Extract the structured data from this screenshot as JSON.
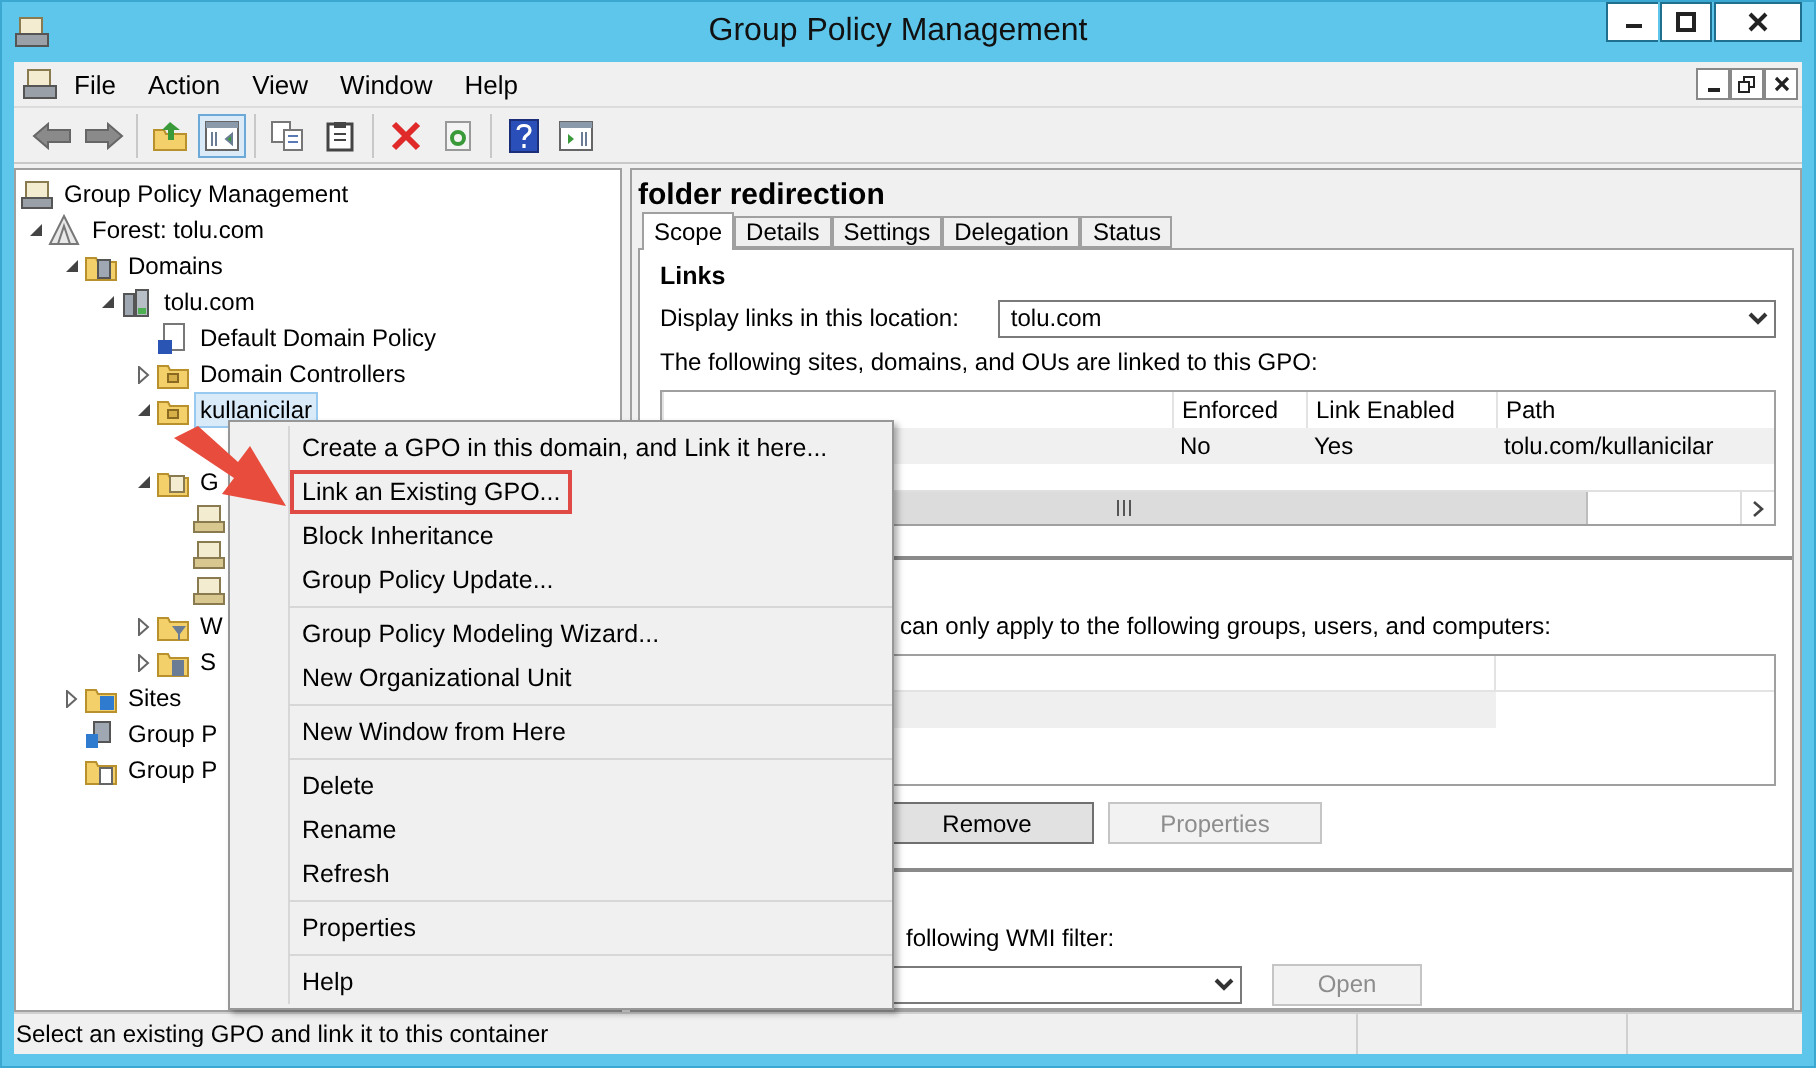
{
  "window": {
    "title": "Group Policy Management"
  },
  "menubar": [
    "File",
    "Action",
    "View",
    "Window",
    "Help"
  ],
  "toolbar": [
    [
      {
        "kind": "back",
        "pressed": false
      },
      {
        "kind": "forward",
        "pressed": false
      }
    ],
    [
      {
        "kind": "up",
        "pressed": false
      },
      {
        "kind": "tree",
        "pressed": true
      }
    ],
    [
      {
        "kind": "copy",
        "pressed": false
      },
      {
        "kind": "paste",
        "pressed": false
      }
    ],
    [
      {
        "kind": "delete",
        "pressed": false
      },
      {
        "kind": "refresh",
        "pressed": false
      }
    ],
    [
      {
        "kind": "help",
        "pressed": false
      },
      {
        "kind": "pane",
        "pressed": false
      }
    ]
  ],
  "tree": [
    {
      "kind": "console",
      "label": "Group Policy Management",
      "selected": false,
      "children": [
        {
          "kind": "forest",
          "label": "Forest: tolu.com",
          "expanded": true,
          "selected": false,
          "children": [
            {
              "kind": "domains",
              "label": "Domains",
              "expanded": true,
              "selected": false,
              "children": [
                {
                  "kind": "domain",
                  "label": "tolu.com",
                  "expanded": true,
                  "selected": false,
                  "children": [
                    {
                      "kind": "gpo-link",
                      "label": "Default Domain Policy",
                      "selected": false
                    },
                    {
                      "kind": "ou",
                      "label": "Domain Controllers",
                      "expanded": false,
                      "selected": false
                    },
                    {
                      "kind": "ou",
                      "label": "kullanicilar",
                      "expanded": true,
                      "selected": true,
                      "children": [
                        {
                          "kind": "blank"
                        }
                      ]
                    },
                    {
                      "kind": "gpo-folder",
                      "label": "G",
                      "expanded": true,
                      "selected": false,
                      "children": [
                        {
                          "kind": "gpo"
                        },
                        {
                          "kind": "gpo"
                        },
                        {
                          "kind": "gpo"
                        }
                      ]
                    },
                    {
                      "kind": "wmi",
                      "label": "W",
                      "expanded": false,
                      "selected": false
                    },
                    {
                      "kind": "starter",
                      "label": "S",
                      "expanded": false,
                      "selected": false
                    }
                  ]
                }
              ]
            },
            {
              "kind": "sites",
              "label": "Sites",
              "expanded": false,
              "selected": false
            },
            {
              "kind": "modeling",
              "label": "Group P",
              "selected": false
            },
            {
              "kind": "results",
              "label": "Group P",
              "selected": false
            }
          ]
        }
      ]
    }
  ],
  "details": {
    "title": "folder redirection",
    "tabs": [
      {
        "label": "Scope",
        "selected": true
      },
      {
        "label": "Details",
        "selected": false
      },
      {
        "label": "Settings",
        "selected": false
      },
      {
        "label": "Delegation",
        "selected": false
      },
      {
        "label": "Status",
        "selected": false
      }
    ],
    "links": {
      "heading": "Links",
      "location_label": "Display links in this location:",
      "location_value": "tolu.com",
      "intro": "The following sites, domains, and OUs are linked to this GPO:",
      "columns": [
        "Enforced",
        "Link Enabled",
        "Path"
      ],
      "rows": [
        [
          "No",
          "Yes",
          "tolu.com/kullanicilar"
        ]
      ]
    },
    "security": {
      "intro": "can only apply to the following groups, users, and computers:",
      "buttons": [
        {
          "label": "Remove",
          "disabled": false
        },
        {
          "label": "Properties",
          "disabled": true
        }
      ]
    },
    "wmi": {
      "intro": "following WMI filter:",
      "button": {
        "label": "Open",
        "disabled": true
      }
    }
  },
  "context_menu": {
    "groups": [
      [
        {
          "label": "Create a GPO in this domain, and Link it here...",
          "highlighted": false
        },
        {
          "label": "Link an Existing GPO...",
          "highlighted": true
        },
        {
          "label": "Block Inheritance",
          "highlighted": false
        },
        {
          "label": "Group Policy Update...",
          "highlighted": false
        }
      ],
      [
        {
          "label": "Group Policy Modeling Wizard...",
          "highlighted": false
        },
        {
          "label": "New Organizational Unit",
          "highlighted": false
        }
      ],
      [
        {
          "label": "New Window from Here",
          "highlighted": false
        }
      ],
      [
        {
          "label": "Delete",
          "highlighted": false
        },
        {
          "label": "Rename",
          "highlighted": false
        },
        {
          "label": "Refresh",
          "highlighted": false
        }
      ],
      [
        {
          "label": "Properties",
          "highlighted": false
        }
      ],
      [
        {
          "label": "Help",
          "highlighted": false
        }
      ]
    ]
  },
  "status_bar": "Select an existing GPO and link it to this container"
}
